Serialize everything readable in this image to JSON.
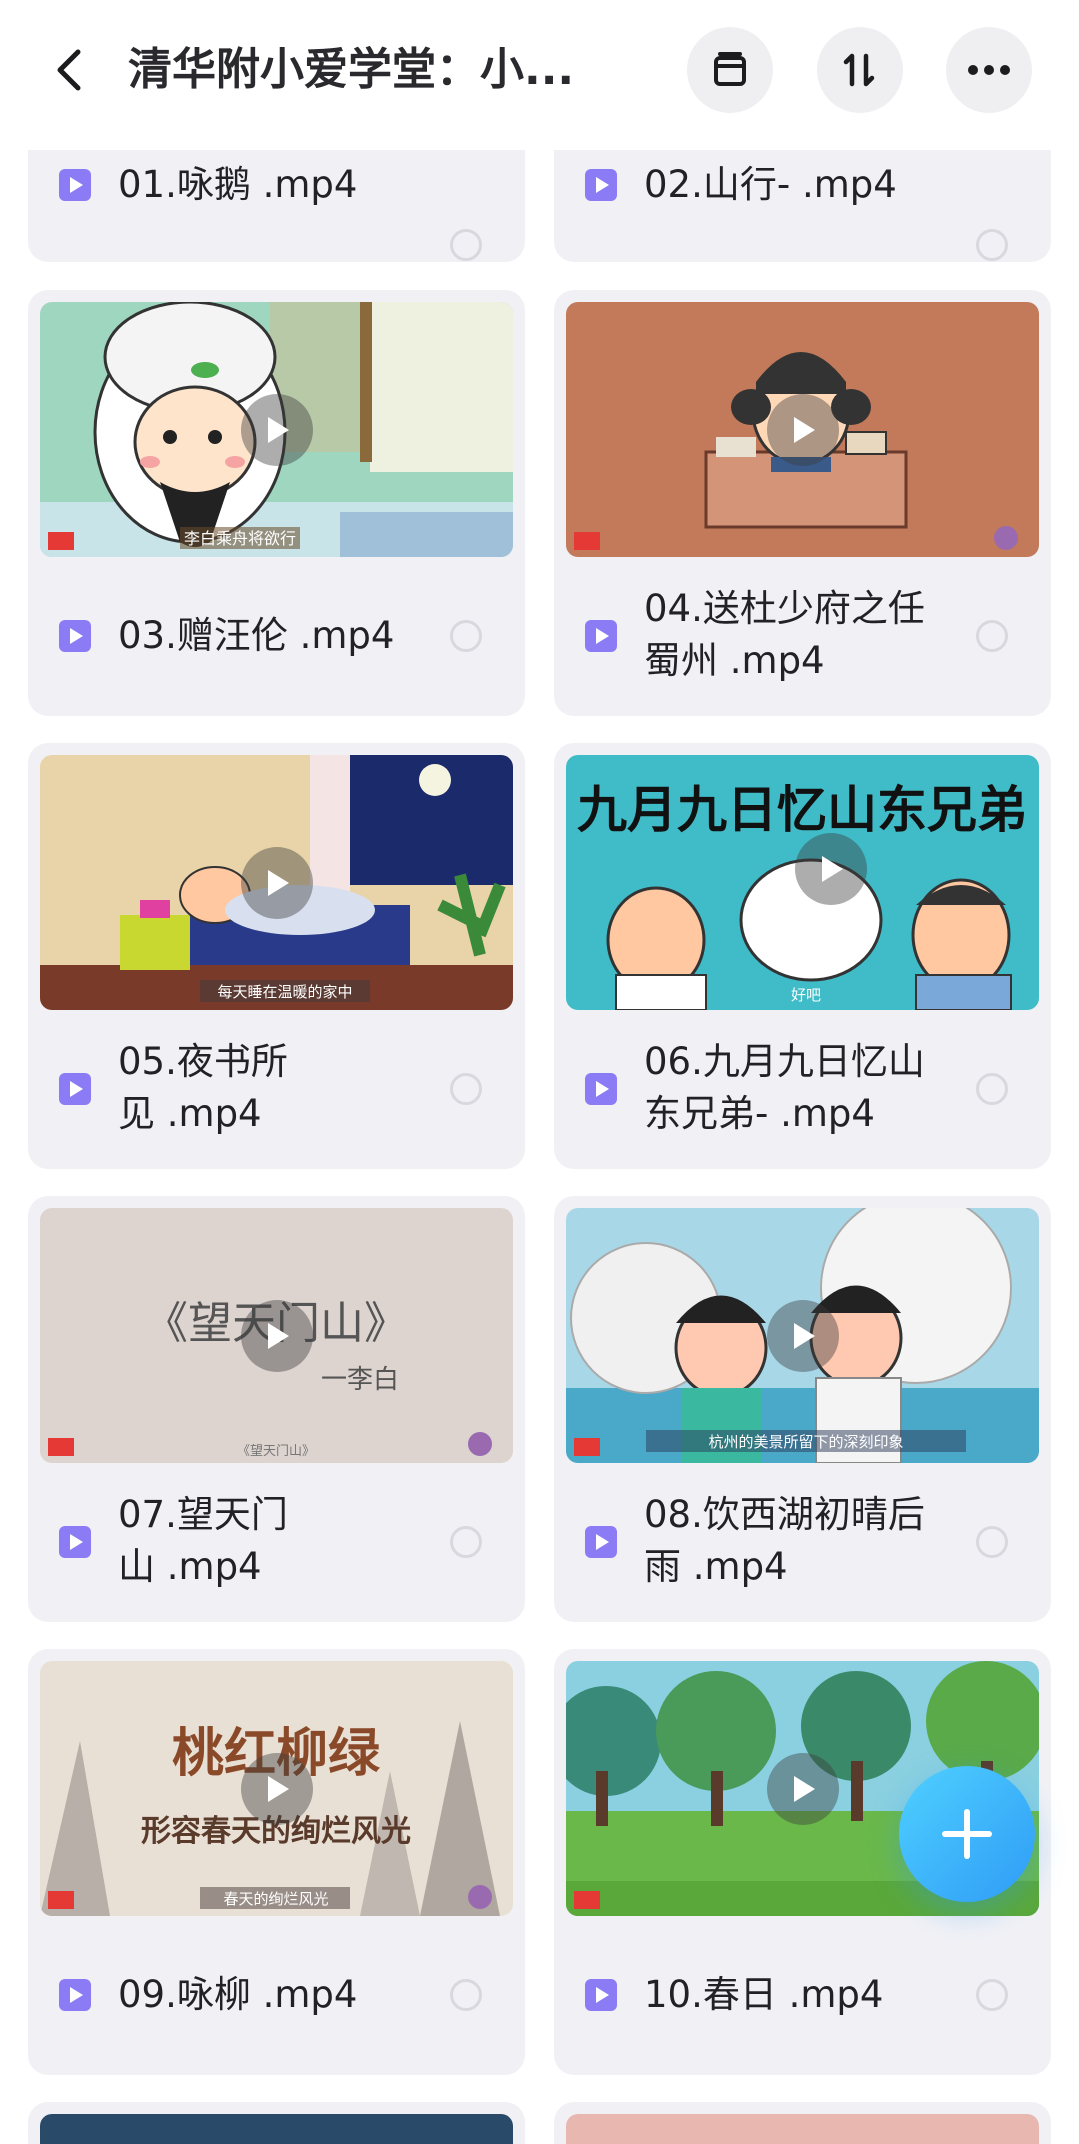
{
  "header": {
    "title": "清华附小爱学堂：小...",
    "back_icon": "chevron-left-icon",
    "buttons": [
      {
        "name": "archive-icon"
      },
      {
        "name": "sort-icon"
      },
      {
        "name": "more-icon"
      }
    ]
  },
  "files": [
    {
      "name": "01.咏鹅 .mp4",
      "line1": "01.咏鹅 .mp4",
      "line2": ""
    },
    {
      "name": "02.山行- .mp4",
      "line1": "02.山行- .mp4",
      "line2": ""
    },
    {
      "name": "03.赠汪伦 .mp4",
      "line1": "03.赠汪伦 .mp4",
      "line2": ""
    },
    {
      "name": "04.送杜少府之任蜀州 .mp4",
      "line1": "04.送杜少府之任",
      "line2": "蜀州 .mp4"
    },
    {
      "name": "05.夜书所见 .mp4",
      "line1": "05.夜书所",
      "line2": "见 .mp4"
    },
    {
      "name": "06.九月九日忆山东兄弟- .mp4",
      "line1": "06.九月九日忆山",
      "line2": "东兄弟- .mp4"
    },
    {
      "name": "07.望天门山 .mp4",
      "line1": "07.望天门",
      "line2": "山 .mp4"
    },
    {
      "name": "08.饮西湖初晴后雨 .mp4",
      "line1": "08.饮西湖初晴后",
      "line2": "雨 .mp4"
    },
    {
      "name": "09.咏柳 .mp4",
      "line1": "09.咏柳 .mp4",
      "line2": ""
    },
    {
      "name": "10.春日 .mp4",
      "line1": "10.春日 .mp4",
      "line2": ""
    }
  ],
  "thumbnails": {
    "t03": {
      "caption": "李白乘舟将欲行"
    },
    "t05": {
      "caption": "每天睡在温暖的家中"
    },
    "t06": {
      "title": "九月九日忆山东兄弟",
      "caption": "好吧"
    },
    "t07": {
      "title": "《望天门山》",
      "author": "一李白",
      "caption": "《望天门山》"
    },
    "t08": {
      "caption": "杭州的美景所留下的深刻印象"
    },
    "t09": {
      "title": "桃红柳绿",
      "subtitle": "形容春天的绚烂风光",
      "caption": "春天的绚烂风光"
    }
  },
  "fab": {
    "icon": "plus-icon"
  },
  "colors": {
    "accent": "#2f9cf6",
    "file_icon": "#8b7cf6",
    "card_bg": "#f1f1f5"
  }
}
